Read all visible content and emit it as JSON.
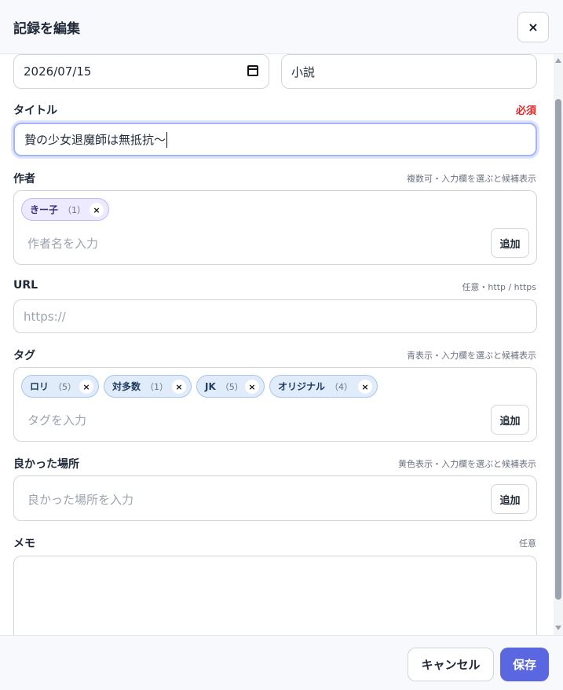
{
  "dialog": {
    "title": "記録を編集",
    "close_label": "×"
  },
  "fields": {
    "date_value": "2026/07/15",
    "category_value": "小説",
    "title": {
      "label": "タイトル",
      "required": "必須",
      "value": "贄の少女退魔師は無抵抗〜"
    },
    "author": {
      "label": "作者",
      "hint": "複数可・入力欄を選ぶと候補表示",
      "chips": [
        {
          "name": "きー子",
          "count": "（1）"
        }
      ],
      "placeholder": "作者名を入力",
      "add_label": "追加"
    },
    "url": {
      "label": "URL",
      "hint": "任意・http / https",
      "placeholder": "https://"
    },
    "tags": {
      "label": "タグ",
      "hint": "青表示・入力欄を選ぶと候補表示",
      "chips": [
        {
          "name": "ロリ",
          "count": "（5）"
        },
        {
          "name": "対多数",
          "count": "（1）"
        },
        {
          "name": "JK",
          "count": "（5）"
        },
        {
          "name": "オリジナル",
          "count": "（4）"
        }
      ],
      "placeholder": "タグを入力",
      "add_label": "追加"
    },
    "good_places": {
      "label": "良かった場所",
      "hint": "黄色表示・入力欄を選ぶと候補表示",
      "placeholder": "良かった場所を入力",
      "add_label": "追加"
    },
    "memo": {
      "label": "メモ",
      "hint": "任意"
    }
  },
  "chip_remove_label": "×",
  "footer": {
    "cancel_label": "キャンセル",
    "save_label": "保存"
  },
  "colors": {
    "accent": "#5b67e0",
    "required": "#dc2626",
    "author_chip": "#ede9fe",
    "tag_chip": "#e0ecfa"
  }
}
